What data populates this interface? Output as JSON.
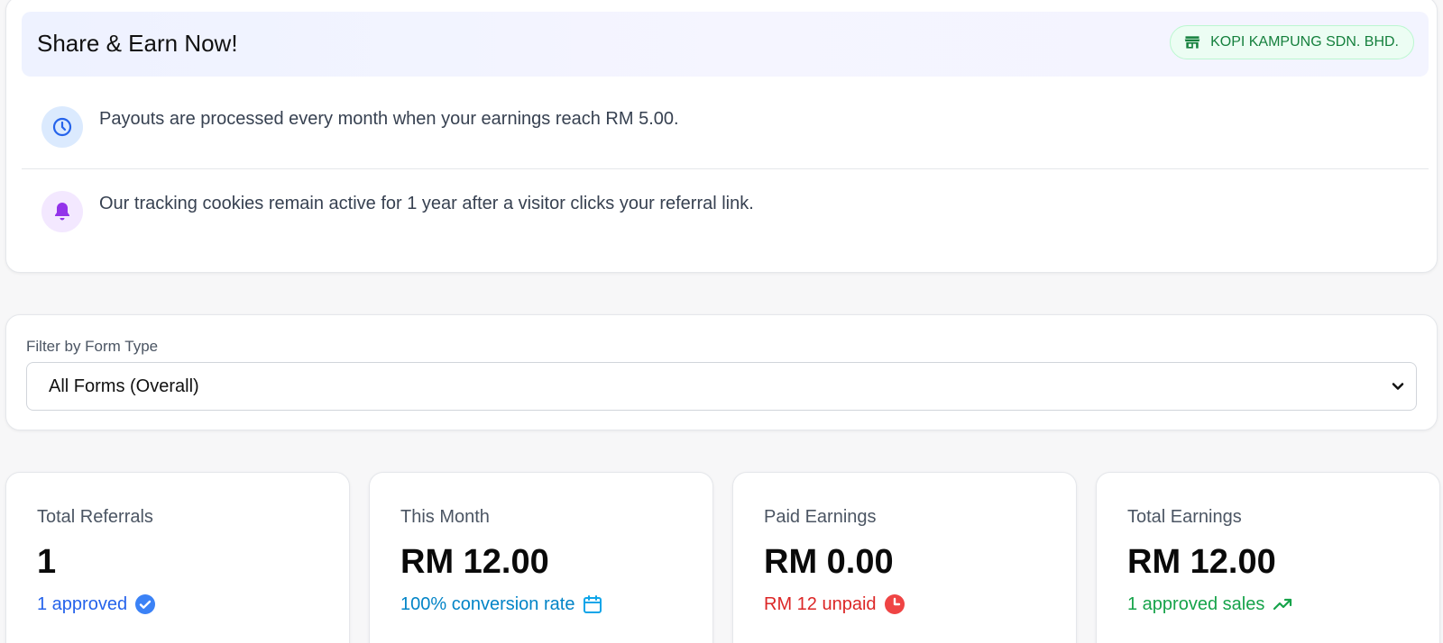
{
  "share": {
    "title": "Share & Earn Now!",
    "company": "KOPI KAMPUNG SDN. BHD.",
    "info": [
      {
        "icon": "clock-icon",
        "text": "Payouts are processed every month when your earnings reach RM 5.00."
      },
      {
        "icon": "bell-icon",
        "text": "Our tracking cookies remain active for 1 year after a visitor clicks your referral link."
      }
    ]
  },
  "filter": {
    "label": "Filter by Form Type",
    "selected": "All Forms (Overall)"
  },
  "stats": [
    {
      "label": "Total Referrals",
      "value": "1",
      "sub": "1 approved",
      "icon": "check-badge-icon"
    },
    {
      "label": "This Month",
      "value": "RM 12.00",
      "sub": "100% conversion rate",
      "icon": "calendar-icon"
    },
    {
      "label": "Paid Earnings",
      "value": "RM 0.00",
      "sub": "RM 12 unpaid",
      "icon": "clock-filled-icon"
    },
    {
      "label": "Total Earnings",
      "value": "RM 12.00",
      "sub": "1 approved sales",
      "icon": "trending-up-icon"
    }
  ],
  "colors": {
    "accent_blue": "#2563eb",
    "accent_sky": "#0284c7",
    "accent_red": "#dc2626",
    "accent_green": "#16a34a",
    "badge_bg": "#ecfdf3"
  }
}
